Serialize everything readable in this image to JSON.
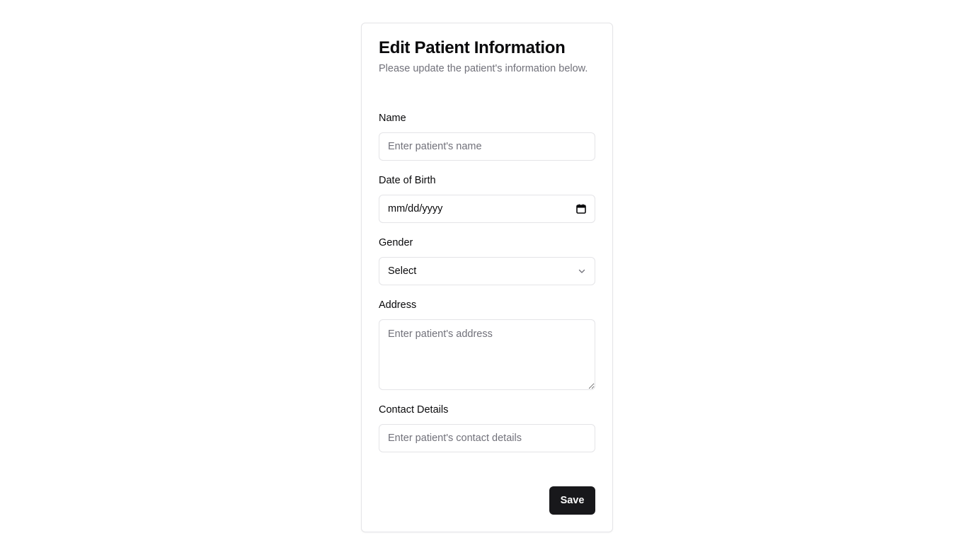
{
  "form": {
    "title": "Edit Patient Information",
    "subtitle": "Please update the patient's information below.",
    "name": {
      "label": "Name",
      "placeholder": "Enter patient's name",
      "value": ""
    },
    "dob": {
      "label": "Date of Birth",
      "display": "mm/dd/yyyy"
    },
    "gender": {
      "label": "Gender",
      "selected": "Select"
    },
    "address": {
      "label": "Address",
      "placeholder": "Enter patient's address",
      "value": ""
    },
    "contact": {
      "label": "Contact Details",
      "placeholder": "Enter patient's contact details",
      "value": ""
    },
    "save_label": "Save"
  },
  "icons": {
    "calendar": "calendar-icon",
    "chevron": "chevron-down-icon"
  },
  "colors": {
    "primary_button": "#18181b",
    "border": "#e4e4e7",
    "muted_text": "#71717a"
  }
}
